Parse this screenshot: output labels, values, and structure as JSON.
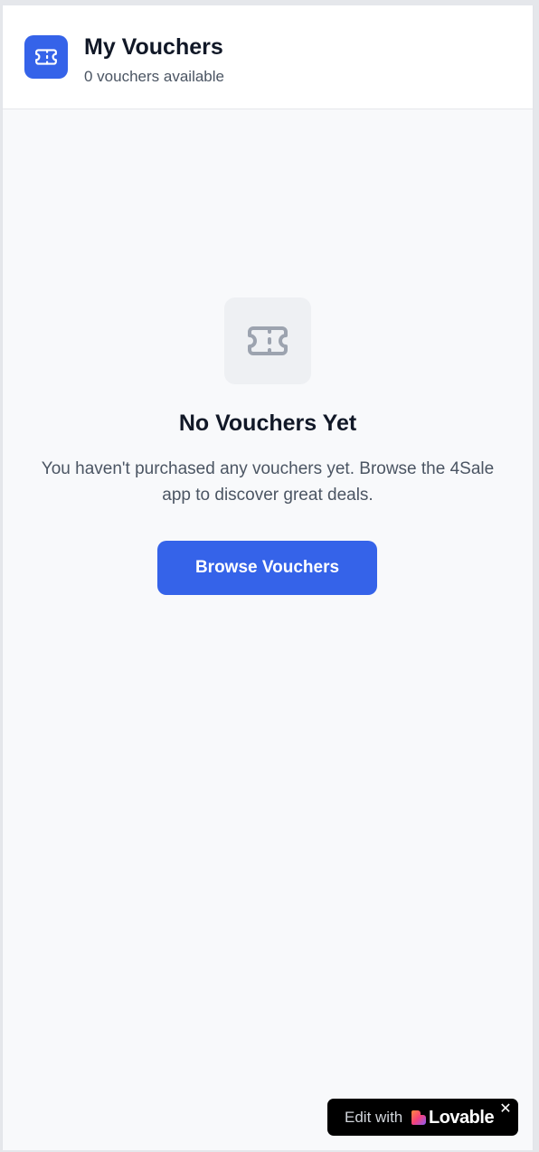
{
  "header": {
    "title": "My Vouchers",
    "subtitle": "0 vouchers available",
    "icon": "ticket-icon",
    "accent_color": "#3563e9"
  },
  "empty_state": {
    "icon": "ticket-icon",
    "title": "No Vouchers Yet",
    "description": "You haven't purchased any vouchers yet. Browse the 4Sale app to discover great deals.",
    "button_label": "Browse Vouchers"
  },
  "badge": {
    "edit_text": "Edit with",
    "brand": "Lovable",
    "logo_icon": "lovable-heart-icon",
    "close_icon": "close-icon",
    "close_glyph": "✕"
  }
}
